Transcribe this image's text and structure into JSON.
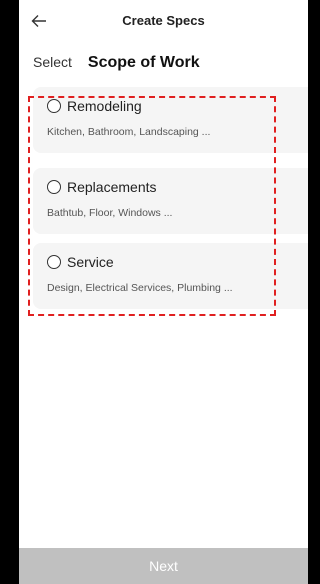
{
  "header": {
    "title": "Create Specs",
    "back_icon": "arrow-left-icon"
  },
  "section": {
    "select_label": "Select",
    "title": "Scope of Work"
  },
  "options": [
    {
      "title": "Remodeling",
      "subtitle": "Kitchen, Bathroom, Landscaping ...",
      "selected": false
    },
    {
      "title": "Replacements",
      "subtitle": "Bathtub, Floor, Windows ...",
      "selected": false
    },
    {
      "title": "Service",
      "subtitle": "Design, Electrical Services, Plumbing ...",
      "selected": false
    }
  ],
  "footer": {
    "next_label": "Next"
  },
  "colors": {
    "highlight": "#e02020",
    "card_bg": "#f5f5f5",
    "next_button_bg": "#c0c0c0"
  }
}
